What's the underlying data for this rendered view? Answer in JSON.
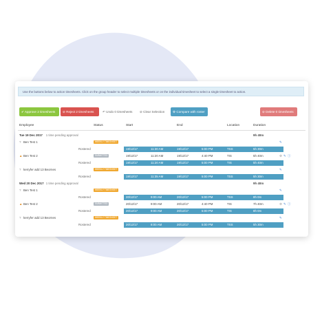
{
  "info_text": "Use the buttons below to action timesheets. Click on the group header to select multiple timesheets or on the individual timesheet to select a single timesheet to action.",
  "buttons": {
    "approve": "✔ Approve 2 timesheets",
    "reject": "⊘ Reject 2 timesheets",
    "undo": "↶ Undo 0 timesheets",
    "clear": "⊘ Clear Selection",
    "compare": "⚙ Compare with roster",
    "delete": "⊘ Delete 0 timesheets"
  },
  "colors": {
    "approve": "#8cc63f",
    "reject": "#d9534f",
    "compare": "#4f9fc3",
    "delete": "#e07b7b",
    "bar": "#4f9fc3",
    "badge_orange": "#f0a830",
    "badge_grey": "#b0b8c0"
  },
  "headers": {
    "employee": "Employee",
    "status": "Status",
    "start": "Start",
    "end": "End",
    "location": "Location",
    "duration": "Duration"
  },
  "groups": [
    {
      "date": "Tue 19 Dec 2017",
      "pending": "1 time pending approval",
      "total": "9h 40m",
      "rows": [
        {
          "name": "Ben Test 1",
          "icon": "info",
          "badge": "WEEKLY TIMESHEET",
          "badge_color": "orange",
          "rostered": "Rostered",
          "bar": [
            "19/12/17",
            "11:30 AM",
            "19/12/17",
            "5:00 PM",
            "TSS",
            "5h 30m"
          ]
        },
        {
          "name": "Ben Test 2",
          "icon": "warn",
          "badge": "SUBMITTED",
          "badge_color": "grey",
          "actual": [
            "19/12/17",
            "11:20 AM",
            "19/12/17",
            "4:40 PM",
            "TIS",
            "5h 40m"
          ],
          "rostered": "Rostered",
          "bar": [
            "19/12/17",
            "11:20 AM",
            "19/12/17",
            "5:00 PM",
            "TIS",
            "5h 40m"
          ]
        },
        {
          "name": "kerryfer add 13 Beornes",
          "icon": "info",
          "badge": "WEEKLY TIMESHEET",
          "badge_color": "orange",
          "rostered": "Rostered",
          "bar": [
            "19/12/17",
            "11:35 AM",
            "19/12/17",
            "5:00 PM",
            "TSS",
            "5h 30m"
          ]
        }
      ]
    },
    {
      "date": "Wed 20 Dec 2017",
      "pending": "1 time pending approval",
      "total": "9h 40m",
      "rows": [
        {
          "name": "Ben Test 1",
          "icon": "info",
          "badge": "WEEKLY TIMESHEET",
          "badge_color": "orange",
          "rostered": "Rostered",
          "bar": [
            "20/12/17",
            "9:00 AM",
            "20/12/17",
            "5:00 PM",
            "TSS",
            "8h 0m"
          ]
        },
        {
          "name": "Ben Test 2",
          "icon": "warn",
          "badge": "SUBMITTED",
          "badge_color": "grey",
          "actual": [
            "20/12/17",
            "9:00 AM",
            "20/12/17",
            "4:40 PM",
            "TIS",
            "7h 40m"
          ],
          "rostered": "Rostered",
          "bar": [
            "20/12/17",
            "9:00 AM",
            "20/12/17",
            "5:00 PM",
            "TIS",
            "8h 0m"
          ]
        },
        {
          "name": "kerryfer add 13 Beornes",
          "icon": "info",
          "badge": "WEEKLY TIMESHEET",
          "badge_color": "orange",
          "rostered": "Rostered",
          "bar": [
            "20/12/17",
            "8:00 AM",
            "20/12/17",
            "5:00 PM",
            "TSS",
            "5h 30m"
          ]
        }
      ]
    }
  ]
}
